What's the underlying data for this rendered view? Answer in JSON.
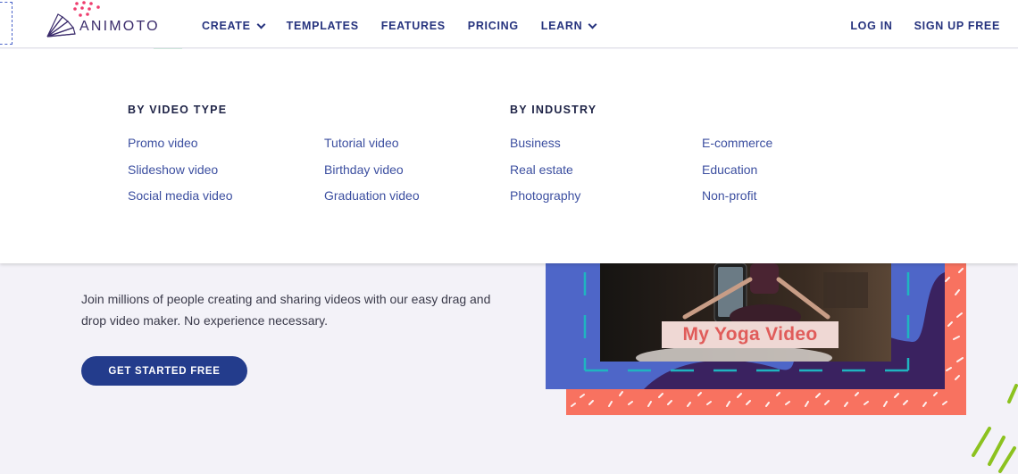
{
  "brand": {
    "name": "ANIMOTO"
  },
  "nav": {
    "items": [
      {
        "label": "CREATE",
        "has_dropdown": true
      },
      {
        "label": "TEMPLATES",
        "has_dropdown": false
      },
      {
        "label": "FEATURES",
        "has_dropdown": false
      },
      {
        "label": "PRICING",
        "has_dropdown": false
      },
      {
        "label": "LEARN",
        "has_dropdown": true
      }
    ],
    "right": [
      {
        "label": "LOG IN"
      },
      {
        "label": "SIGN UP FREE"
      }
    ]
  },
  "menu": {
    "video_type": {
      "heading": "BY VIDEO TYPE",
      "col1": [
        "Promo video",
        "Slideshow video",
        "Social media video"
      ],
      "col2": [
        "Tutorial video",
        "Birthday video",
        "Graduation video"
      ]
    },
    "industry": {
      "heading": "BY INDUSTRY",
      "col1": [
        "Business",
        "Real estate",
        "Photography"
      ],
      "col2": [
        "E-commerce",
        "Education",
        "Non-profit"
      ]
    }
  },
  "hero": {
    "description": "Join millions of people creating and sharing videos with our easy drag and drop video maker. No experience necessary.",
    "cta_label": "GET STARTED FREE",
    "video_title": "My Yoga Video"
  },
  "colors": {
    "brand_navy": "#26337e",
    "cta": "#233c8c",
    "link": "#3c4fa0",
    "coral": "#f87260",
    "blue_frame": "#4e66c8",
    "teal_dash": "#1fb5c0"
  }
}
